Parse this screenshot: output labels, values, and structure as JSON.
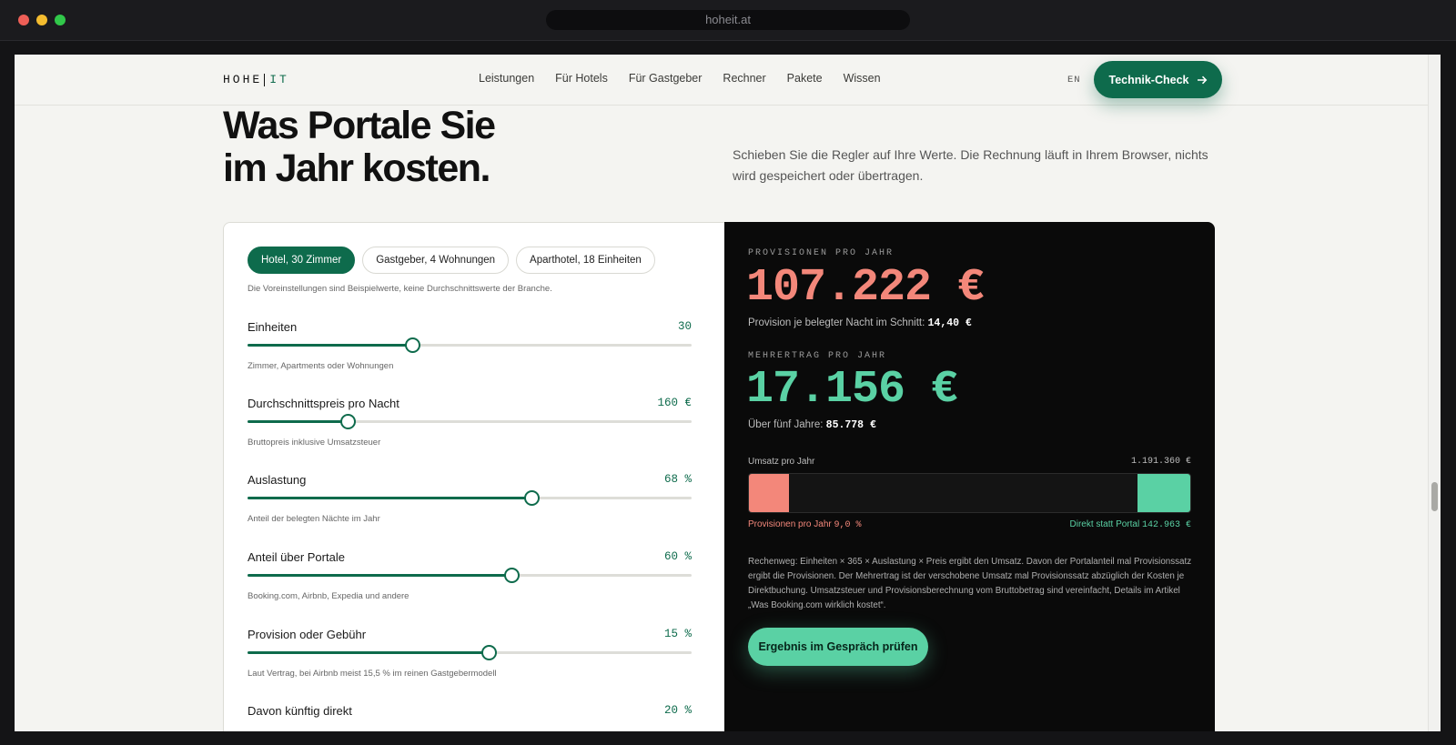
{
  "browser": {
    "url": "hoheit.at"
  },
  "header": {
    "logo_left": "HOHE",
    "logo_right": "IT",
    "nav": [
      "Leistungen",
      "Für Hotels",
      "Für Gastgeber",
      "Rechner",
      "Pakete",
      "Wissen"
    ],
    "lang": "EN",
    "cta_label": "Technik-Check",
    "cta_icon": "arrow-right-icon"
  },
  "hero": {
    "headline_line1": "Was Portale Sie",
    "headline_line2": "im Jahr kosten.",
    "lede": "Schieben Sie die Regler auf Ihre Werte. Die Rechnung läuft in Ihrem Browser, nichts wird gespeichert oder übertragen."
  },
  "calculator": {
    "presets": [
      "Hotel, 30 Zimmer",
      "Gastgeber, 4 Wohnungen",
      "Aparthotel, 18 Einheiten"
    ],
    "active_preset": 0,
    "preset_note": "Die Voreinstellungen sind Beispielwerte, keine Durchschnittswerte der Branche.",
    "sliders": [
      {
        "label": "Einheiten",
        "value": "30",
        "level": 0.37,
        "hint": "Zimmer, Apartments oder Wohnungen"
      },
      {
        "label": "Durchschnittspreis pro Nacht",
        "value": "160 €",
        "level": 0.225,
        "hint": "Bruttopreis inklusive Umsatzsteuer"
      },
      {
        "label": "Auslastung",
        "value": "68 %",
        "level": 0.64,
        "hint": "Anteil der belegten Nächte im Jahr"
      },
      {
        "label": "Anteil über Portale",
        "value": "60 %",
        "level": 0.595,
        "hint": "Booking.com, Airbnb, Expedia und andere"
      },
      {
        "label": "Provision oder Gebühr",
        "value": "15 %",
        "level": 0.543,
        "hint": "Laut Vertrag, bei Airbnb meist 15,5 % im reinen Gastgebermodell"
      },
      {
        "label": "Davon künftig direkt",
        "value": "20 %",
        "level": 0.2,
        "hint": ""
      }
    ]
  },
  "results": {
    "commission_kicker": "PROVISIONEN PRO JAHR",
    "commission_value": "107.222 €",
    "commission_sub_label": "Provision je belegter Nacht im Schnitt:",
    "commission_sub_value": "14,40 €",
    "gain_kicker": "MEHRERTRAG PRO JAHR",
    "gain_value": "17.156 €",
    "gain_sub_label": "Über fünf Jahre:",
    "gain_sub_value": "85.778 €",
    "bar_label": "Umsatz pro Jahr",
    "bar_total": "1.191.360 €",
    "commission_share": 0.09,
    "direct_share": 0.12,
    "bar_left_label": "Provisionen pro Jahr",
    "bar_left_value": "9,0 %",
    "bar_right_label": "Direkt statt Portal",
    "bar_right_value": "142.963 €",
    "method": "Rechenweg: Einheiten × 365 × Auslastung × Preis ergibt den Umsatz. Davon der Portalanteil mal Provisionssatz ergibt die Provisionen. Der Mehrertrag ist der verschobene Umsatz mal Provisionssatz abzüglich der Kosten je Direktbuchung. Umsatzsteuer und Provisionsberechnung vom Bruttobetrag sind vereinfacht, Details im Artikel „Was Booking.com wirklich kostet“.",
    "cta_label": "Ergebnis im Gespräch prüfen"
  },
  "colors": {
    "brand_green": "#0e6b4c",
    "accent_mint": "#5ad1a4",
    "accent_coral": "#f3877a"
  }
}
